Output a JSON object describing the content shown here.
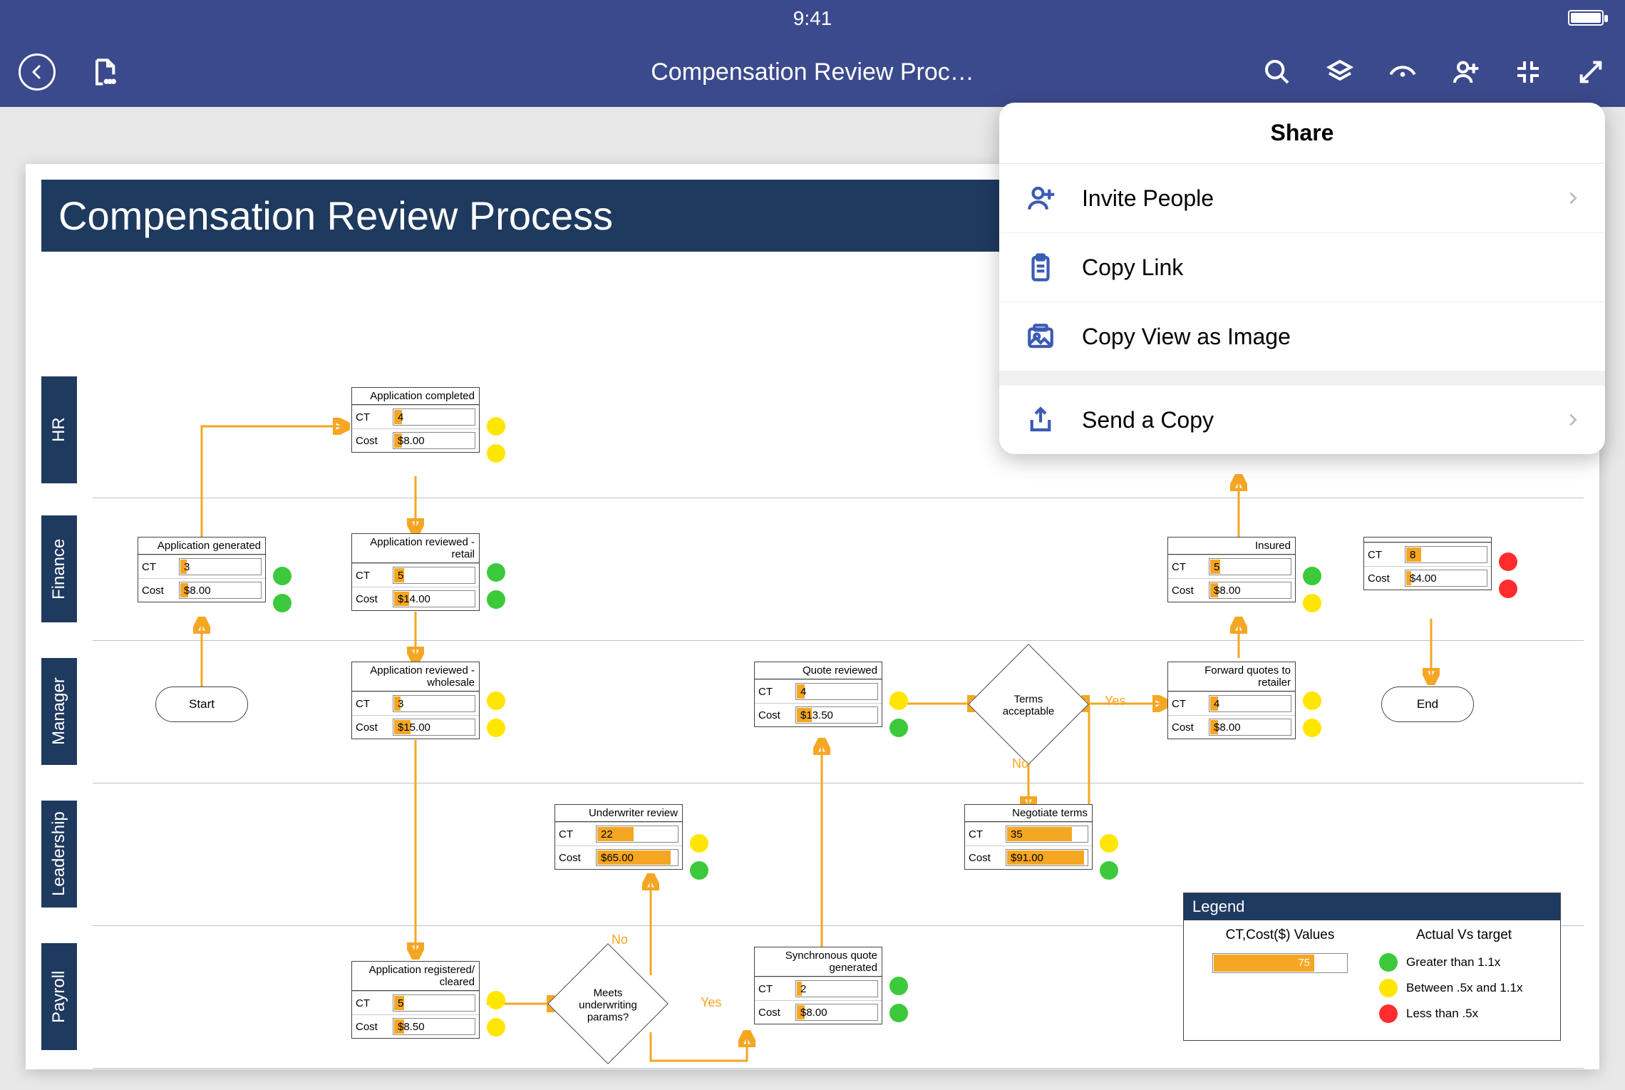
{
  "status": {
    "time": "9:41"
  },
  "appbar": {
    "title": "Compensation Review Proc…"
  },
  "share": {
    "title": "Share",
    "items": {
      "invite": "Invite People",
      "copylink": "Copy Link",
      "copyimage": "Copy View as Image",
      "sendcopy": "Send a Copy"
    }
  },
  "doc": {
    "title": "Compensation Review Process"
  },
  "lanes": [
    "HR",
    "Finance",
    "Manager",
    "Leadership",
    "Payroll"
  ],
  "nodes": {
    "app_completed": {
      "title": "Application completed",
      "ct": "4",
      "cost": "$8.00",
      "ctbar": 10,
      "costbar": 10,
      "d1": "y",
      "d2": "y"
    },
    "app_generated": {
      "title": "Application generated",
      "ct": "3",
      "cost": "$8.00",
      "ctbar": 8,
      "costbar": 10,
      "d1": "g",
      "d2": "g"
    },
    "app_rev_retail": {
      "title": "Application reviewed - retail",
      "ct": "5",
      "cost": "$14.00",
      "ctbar": 12,
      "costbar": 18,
      "d1": "g",
      "d2": "g"
    },
    "insured": {
      "title": "Insured",
      "ct": "5",
      "cost": "$8.00",
      "ctbar": 12,
      "costbar": 10,
      "d1": "g",
      "d2": "y"
    },
    "node_fin_r": {
      "title": "",
      "ct": "8",
      "cost": "$4.00",
      "ctbar": 18,
      "costbar": 6,
      "d1": "r",
      "d2": "r"
    },
    "app_rev_whole": {
      "title": "Application reviewed - wholesale",
      "ct": "3",
      "cost": "$15.00",
      "ctbar": 8,
      "costbar": 20,
      "d1": "y",
      "d2": "y"
    },
    "quote_reviewed": {
      "title": "Quote reviewed",
      "ct": "4",
      "cost": "$13.50",
      "ctbar": 10,
      "costbar": 18,
      "d1": "y",
      "d2": "g"
    },
    "fwd_quotes": {
      "title": "Forward quotes to retailer",
      "ct": "4",
      "cost": "$8.00",
      "ctbar": 10,
      "costbar": 10,
      "d1": "y",
      "d2": "y"
    },
    "underwriter": {
      "title": "Underwriter review",
      "ct": "22",
      "cost": "$65.00",
      "ctbar": 45,
      "costbar": 90,
      "d1": "y",
      "d2": "g"
    },
    "negotiate": {
      "title": "Negotiate terms",
      "ct": "35",
      "cost": "$91.00",
      "ctbar": 80,
      "costbar": 95,
      "d1": "y",
      "d2": "g"
    },
    "app_registered": {
      "title": "Application registered/ cleared",
      "ct": "5",
      "cost": "$8.50",
      "ctbar": 12,
      "costbar": 12,
      "d1": "y",
      "d2": "y"
    },
    "sync_quote": {
      "title": "Synchronous quote generated",
      "ct": "2",
      "cost": "$8.00",
      "ctbar": 6,
      "costbar": 10,
      "d1": "g",
      "d2": "g"
    }
  },
  "start": "Start",
  "end": "End",
  "diamonds": {
    "terms": "Terms acceptable",
    "under": "Meets underwriting params?"
  },
  "labels": {
    "yes": "Yes",
    "no": "No"
  },
  "legend": {
    "title": "Legend",
    "col1_head": "CT,Cost($) Values",
    "col2_head": "Actual Vs target",
    "barval": "75",
    "rows": {
      "g": "Greater than 1.1x",
      "y": "Between .5x and 1.1x",
      "r": "Less than .5x"
    }
  }
}
